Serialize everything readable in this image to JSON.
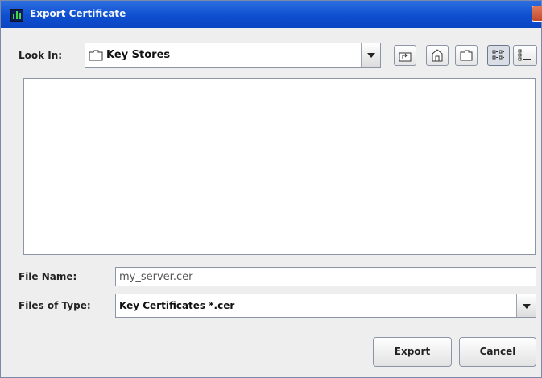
{
  "window": {
    "title": "Export Certificate"
  },
  "look_in": {
    "label_pre": "Look ",
    "label_mnemonic": "I",
    "label_post": "n:",
    "value": "Key Stores",
    "icon": "folder-icon"
  },
  "toolbar": {
    "buttons": [
      {
        "name": "up-one-level",
        "icon": "up-folder-icon"
      },
      {
        "name": "home",
        "icon": "home-icon"
      },
      {
        "name": "new-folder",
        "icon": "new-folder-icon"
      },
      {
        "name": "list-view",
        "icon": "list-view-icon",
        "selected": true
      },
      {
        "name": "details-view",
        "icon": "details-view-icon"
      }
    ]
  },
  "file_list": {
    "items": []
  },
  "file_name": {
    "label_pre": "File ",
    "label_mnemonic": "N",
    "label_post": "ame:",
    "value": "my_server.cer"
  },
  "files_of_type": {
    "label_pre": "Files of ",
    "label_mnemonic": "T",
    "label_post": "ype:",
    "value": "Key Certificates *.cer"
  },
  "buttons": {
    "export": "Export",
    "cancel": "Cancel"
  },
  "colors": {
    "title_bar": "#0e4fd0",
    "window_bg": "#eeeeee",
    "border": "#8b95a6"
  }
}
